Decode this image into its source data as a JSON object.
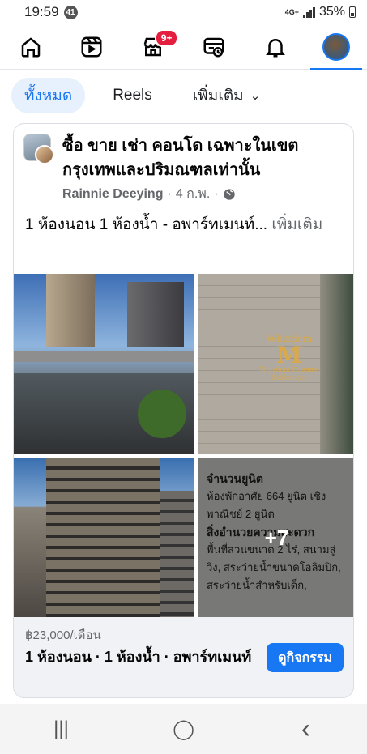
{
  "status_bar": {
    "time": "19:59",
    "notification_count": "41",
    "network": "4G+",
    "battery": "35%"
  },
  "top_nav": {
    "badge": "9+",
    "items": [
      "home-icon",
      "reels-icon",
      "marketplace-icon",
      "feeds-icon",
      "bell-icon",
      "profile-avatar"
    ]
  },
  "filters": [
    {
      "label": "ทั้งหมด",
      "active": true
    },
    {
      "label": "Reels",
      "active": false
    },
    {
      "label": "เพิ่มเติม",
      "active": false
    }
  ],
  "post": {
    "group_name": "ซื้อ ขาย เช่า คอนโด เฉพาะในเขตกรุงเทพและปริมณฑลเท่านั้น",
    "author": "Rainnie Deeying",
    "date": "4 ก.พ.",
    "separator": "·",
    "text": "1 ห้องนอน 1 ห้องน้ำ - อพาร์ทเมนท์...",
    "see_more": "เพิ่มเติม",
    "photo_logo": {
      "line1": "Whizdom",
      "line2": "M",
      "line3": "Whizdom Essence Sukhumvit"
    },
    "info_doc": {
      "heading1": "จำนวนยูนิต",
      "line1": "ห้องพักอาศัย 664 ยูนิต เชิงพาณิชย์ 2 ยูนิต",
      "heading2": "สิ่งอำนวยความสะดวก",
      "line2": "พื้นที่สวนขนาด 2 ไร่, สนามลู่วิ่ง, สระว่ายน้ำขนาดโอลิมปิก, สระว่ายน้ำสำหรับเด็ก,"
    },
    "more_photos": "+7",
    "listing": {
      "price": "฿23,000/เดือน",
      "title": "1 ห้องนอน · 1 ห้องน้ำ · อพาร์ทเมนท์",
      "cta": "ดูกิจกรรม"
    }
  },
  "android_nav": {
    "recents": "|||",
    "home": "◯",
    "back": "‹"
  }
}
